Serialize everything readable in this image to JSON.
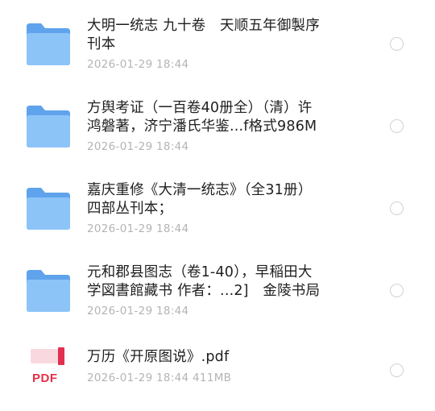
{
  "colors": {
    "folder_back": "#5fa3ec",
    "folder_front": "#8cc4f8",
    "pdf_red": "#e53048",
    "title_text": "#1f1f1f",
    "meta_text": "#b4b4b4"
  },
  "items": [
    {
      "type": "folder",
      "icon": "folder-icon",
      "name_lines": [
        "大明一统志 九十卷　天顺五年御製序",
        "刊本"
      ],
      "meta": "2026-01-29 18:44"
    },
    {
      "type": "folder",
      "icon": "folder-icon",
      "name_lines": [
        "方舆考证（一百卷40册全）（清）许",
        "鸿磐著，济宁潘氏华鉴...f格式986M"
      ],
      "meta": "2026-01-29 18:44"
    },
    {
      "type": "folder",
      "icon": "folder-icon",
      "name_lines": [
        "嘉庆重修《大清一统志》（全31册）",
        "四部丛刊本；"
      ],
      "meta": "2026-01-29 18:44"
    },
    {
      "type": "folder",
      "icon": "folder-icon",
      "name_lines": [
        "元和郡县图志（卷1-40），早稲田大",
        "学図書館藏书 作者：...2]　金陵书局"
      ],
      "meta": "2026-01-29 18:44"
    },
    {
      "type": "pdf",
      "icon": "pdf-file-icon",
      "icon_label": "PDF",
      "name_lines": [
        "万历《开原图说》.pdf"
      ],
      "meta": "2026-01-29 18:44  411MB"
    }
  ]
}
